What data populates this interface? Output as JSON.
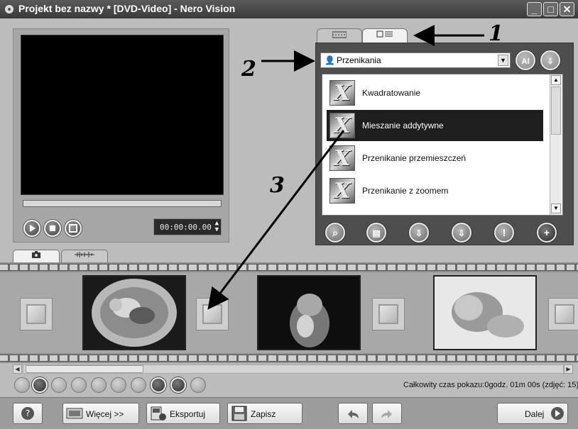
{
  "window": {
    "title": "Projekt bez nazwy * [DVD-Video] - Nero Vision",
    "controls": {
      "minimize": "_",
      "maximize": "□",
      "close": "✕"
    }
  },
  "preview": {
    "timecode": "00:00:00.00",
    "icons": [
      "play-icon",
      "stop-icon",
      "fullscreen-icon"
    ]
  },
  "effects_panel": {
    "category": "Przenikania",
    "items": [
      {
        "label": "Kwadratowanie",
        "selected": false
      },
      {
        "label": "Mieszanie addytywne",
        "selected": true
      },
      {
        "label": "Przenikanie przemieszczeń",
        "selected": false
      },
      {
        "label": "Przenikanie z zoomem",
        "selected": false
      }
    ]
  },
  "annotations": {
    "one": "1",
    "two": "2",
    "three": "3"
  },
  "storyboard": {
    "total_time": "Całkowity czas pokazu:0godz. 01m 00s (zdjęć: 15)"
  },
  "bottom": {
    "more_label": "Więcej >>",
    "export_label": "Eksportuj",
    "save_label": "Zapisz",
    "next_label": "Dalej"
  },
  "colors": {
    "background": "#bcbcbc",
    "titlebar": "#3a3a3a",
    "selected_item": "#1e1e1e",
    "panel": "#4e4e4e"
  }
}
